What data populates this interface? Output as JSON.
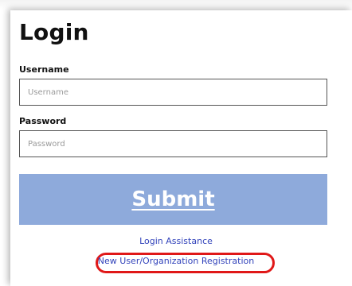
{
  "login": {
    "title": "Login",
    "username_label": "Username",
    "username_placeholder": "Username",
    "username_value": "",
    "password_label": "Password",
    "password_placeholder": "Password",
    "password_value": "",
    "submit_label": "Submit",
    "assistance_link": "Login Assistance",
    "registration_link": "New User/Organization Registration"
  },
  "colors": {
    "submit_background": "#8eaadb",
    "link": "#3344bb",
    "highlight_ring": "#e01818"
  }
}
